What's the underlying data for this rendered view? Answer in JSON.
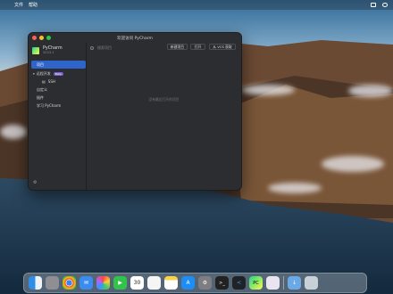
{
  "menubar": {
    "items": [
      "文件",
      "帮助"
    ],
    "status_icons": [
      "control-center-icon",
      "siri-icon"
    ]
  },
  "window": {
    "title": "欢迎访问 PyCharm",
    "brand": {
      "name": "PyCharm",
      "version": "2023.1"
    },
    "nav": [
      {
        "label": "项目",
        "active": true
      },
      {
        "label": "远程开发",
        "badge": "Beta"
      },
      {
        "label": "SSH",
        "indent": true
      },
      {
        "label": "自定义"
      },
      {
        "label": "插件"
      },
      {
        "label": "学习 PyCharm"
      }
    ],
    "search_placeholder": "搜索项目",
    "buttons": {
      "new_project": "新建项目",
      "open": "打开",
      "vcs": "从 VCS 获取"
    },
    "empty_text": "没有最近打开的项目"
  },
  "dock": {
    "apps": [
      "finder-icon",
      "launchpad-icon",
      "chrome-icon",
      "mail-icon",
      "photos-icon",
      "facetime-icon",
      "calendar-icon",
      "reminders-icon",
      "notes-icon",
      "app-store-icon",
      "system-preferences-icon",
      "terminal-icon",
      "vscode-icon",
      "pycharm-icon",
      "preview-icon",
      "downloads-icon",
      "trash-icon"
    ],
    "calendar_day": "30"
  }
}
